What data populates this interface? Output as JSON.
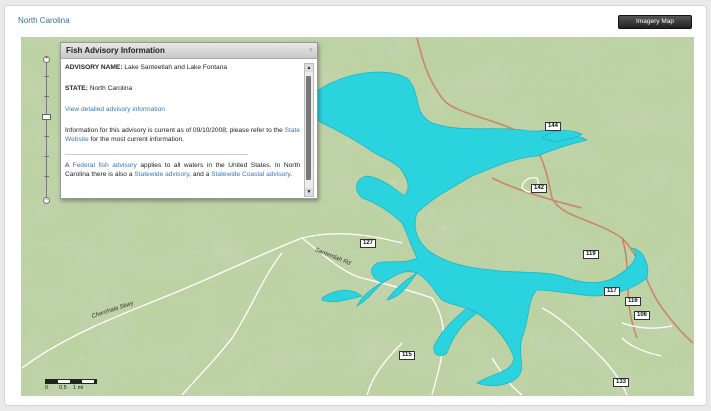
{
  "page": {
    "title": "North Carolina",
    "imagery_button": "Imagery Map"
  },
  "popup": {
    "title": "Fish Advisory Information",
    "close_glyph": "×",
    "advisory_label": "ADVISORY NAME:",
    "advisory_name": "Lake Santeetlah and Lake Fontana",
    "state_label": "STATE:",
    "state_name": "North Carolina",
    "detail_link": "View detailed advisory information",
    "current_text": "Information for this advisory is current as of 09/10/2008; please refer to the",
    "state_website_link": "State Website",
    "current_text_end": "for the most current information.",
    "federal_pre": "A",
    "federal_link": "Federal fish advisory",
    "federal_mid": "applies to all waters in the United States. In North Carolina there is also a",
    "statewide_link": "Statewide advisory",
    "and_text": ", and a",
    "coastal_link": "Statewide Coastal advisory",
    "end_text": "."
  },
  "map": {
    "shields": [
      "144",
      "142",
      "127",
      "119",
      "117",
      "116",
      "106",
      "115",
      "133"
    ],
    "road_labels": [
      "Santeetlah Rd",
      "Cherohala Skwy"
    ],
    "scale": {
      "labels": [
        "0",
        "0.5",
        "1 mi"
      ]
    },
    "colors": {
      "water": "#2bd3df",
      "terrain": "#b9cf9f",
      "highway": "#c9876a",
      "road": "#ffffff"
    }
  },
  "zoom": {
    "plus": "+",
    "minus": "−",
    "level_fraction": 0.37
  }
}
